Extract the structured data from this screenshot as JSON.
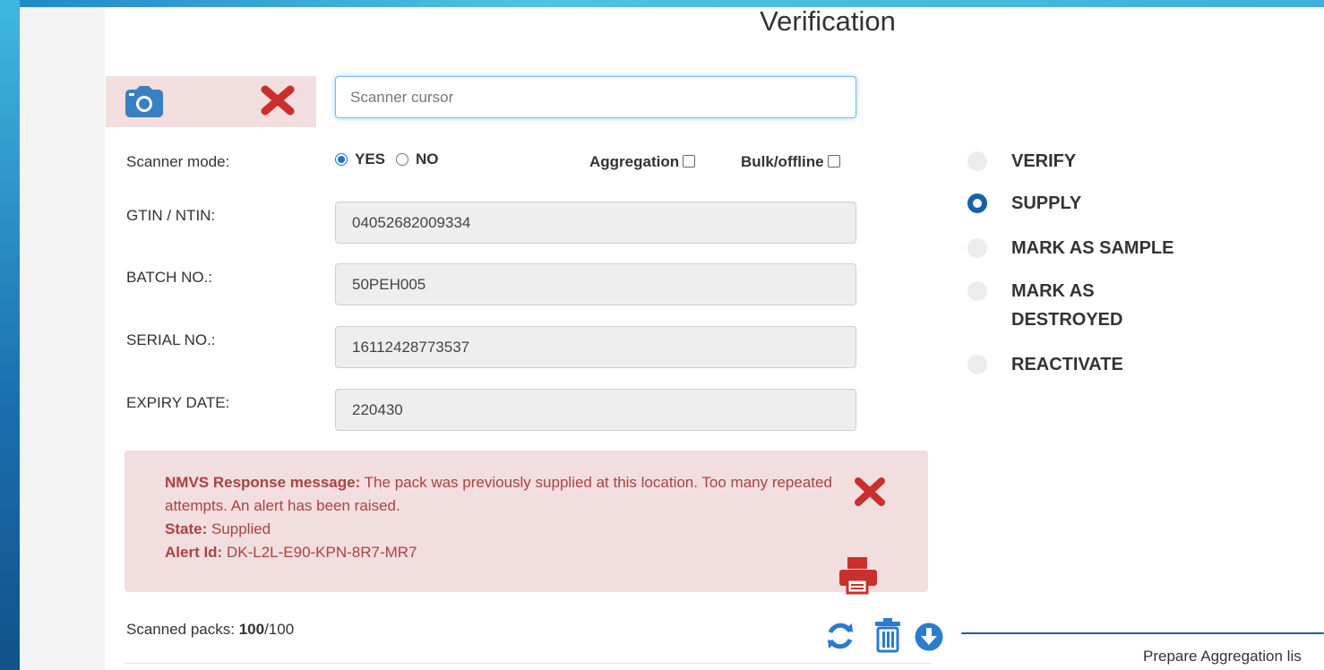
{
  "page": {
    "title": "Verification"
  },
  "scanner": {
    "placeholder": "Scanner cursor",
    "mode_label": "Scanner mode:",
    "mode_yes": "YES",
    "mode_no": "NO",
    "mode_selected": "YES",
    "aggregation_label": "Aggregation",
    "aggregation_checked": false,
    "bulk_label": "Bulk/offline",
    "bulk_checked": false
  },
  "fields": {
    "gtin_label": "GTIN / NTIN:",
    "gtin_value": "04052682009334",
    "batch_label": "BATCH NO.:",
    "batch_value": "50PEH005",
    "serial_label": "SERIAL NO.:",
    "serial_value": "16112428773537",
    "expiry_label": "EXPIRY DATE:",
    "expiry_value": "220430"
  },
  "actions": {
    "selected": "SUPPLY",
    "items": [
      {
        "label": "VERIFY"
      },
      {
        "label": "SUPPLY"
      },
      {
        "label": "MARK AS SAMPLE"
      },
      {
        "label": "MARK AS DESTROYED"
      },
      {
        "label": "REACTIVATE"
      }
    ]
  },
  "response": {
    "message_label": "NMVS Response message:",
    "message_text": "The pack was previously supplied at this location. Too many repeated attempts. An alert has been raised.",
    "state_label": "State:",
    "state_value": "Supplied",
    "alert_label": "Alert Id:",
    "alert_value": "DK-L2L-E90-KPN-8R7-MR7"
  },
  "footer": {
    "scanned_label": "Scanned packs:",
    "scanned_count": "100",
    "scanned_total": "/100",
    "prepare_label": "Prepare Aggregation lis"
  },
  "colors": {
    "accent": "#1561ad",
    "danger": "#c9302c",
    "alert_bg": "#f2dede",
    "alert_text": "#a94442"
  },
  "icons": {
    "camera": "camera-icon",
    "close": "close-icon",
    "print": "print-icon",
    "refresh": "refresh-icon",
    "trash": "trash-icon",
    "download": "download-circle-icon"
  }
}
